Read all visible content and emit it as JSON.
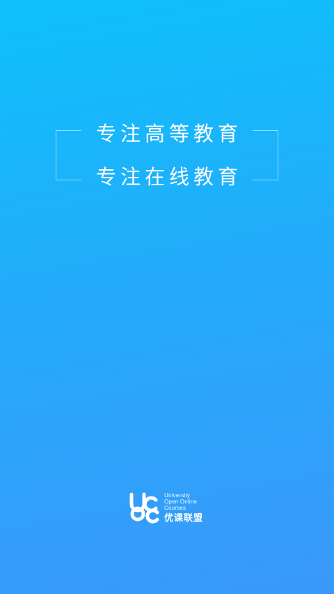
{
  "slogan": {
    "line1": "专注高等教育",
    "line2": "专注在线教育"
  },
  "logo": {
    "icon": "uoc-logo-icon",
    "en_line1": "University",
    "en_line2": "Open Online",
    "en_line3": "Courses",
    "zh_name": "优课联盟"
  },
  "colors": {
    "gradient_top": "#0ec1fb",
    "gradient_bottom": "#3a98f9",
    "text": "#ffffff"
  }
}
